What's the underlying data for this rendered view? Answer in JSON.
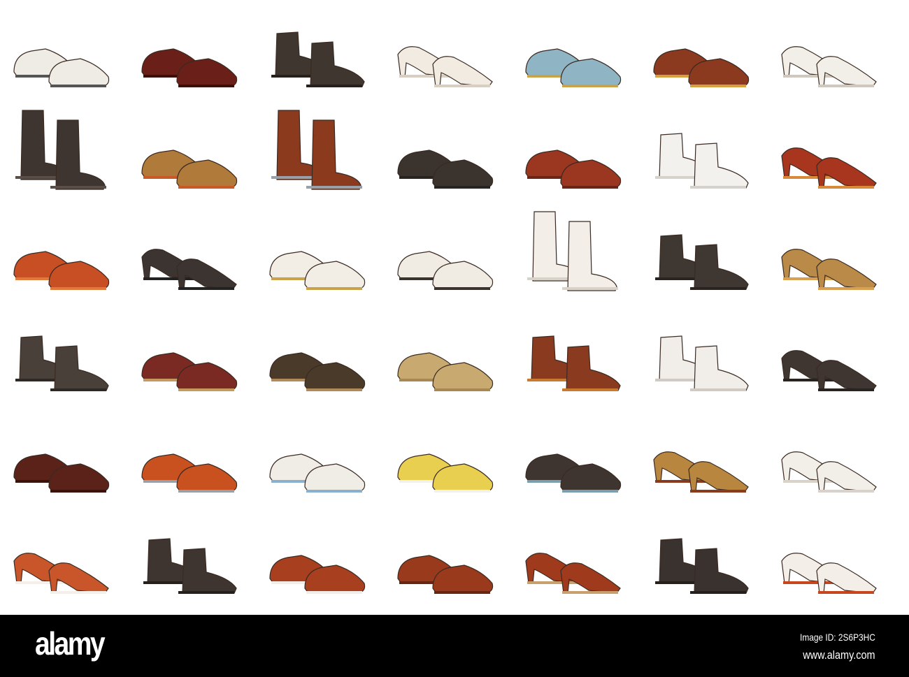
{
  "illustration": {
    "rows": [
      [
        {
          "c": "#efece6",
          "a": "#555"
        },
        {
          "c": "#6a2018",
          "a": "#3a100c"
        },
        {
          "c": "#3f3630",
          "a": "#25201c"
        },
        {
          "c": "#f1ebe2",
          "a": "#d8cfc2"
        },
        {
          "c": "#8fb4c3",
          "a": "#c9a24a"
        },
        {
          "c": "#8b3a1f",
          "a": "#d4a040"
        },
        {
          "c": "#f2eee8",
          "a": "#cfc8be"
        }
      ],
      [
        {
          "c": "#3e3530",
          "a": "#5a4f48"
        },
        {
          "c": "#b07a3a",
          "a": "#c85a25"
        },
        {
          "c": "#8c3a1e",
          "a": "#9aa0a8"
        },
        {
          "c": "#3a332e",
          "a": "#2a2420"
        },
        {
          "c": "#9b3620",
          "a": "#6e2414"
        },
        {
          "c": "#f3f1ee",
          "a": "#d5d2cc"
        },
        {
          "c": "#a8351e",
          "a": "#d88a3a"
        }
      ],
      [
        {
          "c": "#c84f23",
          "a": "#e07a3a"
        },
        {
          "c": "#3b3430",
          "a": "#222"
        },
        {
          "c": "#f2eee6",
          "a": "#c9a24a"
        },
        {
          "c": "#f0ece4",
          "a": "#3a322c"
        },
        {
          "c": "#f3efe8",
          "a": "#d8d2c8"
        },
        {
          "c": "#3e3732",
          "a": "#2a2420"
        },
        {
          "c": "#b98a48",
          "a": "#d8a050"
        }
      ],
      [
        {
          "c": "#4a403a",
          "a": "#2f2925"
        },
        {
          "c": "#7a2a22",
          "a": "#c49a60"
        },
        {
          "c": "#4a3a2a",
          "a": "#b08a5a"
        },
        {
          "c": "#c8aa70",
          "a": "#a88850"
        },
        {
          "c": "#8a3a1e",
          "a": "#c87a30"
        },
        {
          "c": "#f1ede8",
          "a": "#d0cac2"
        },
        {
          "c": "#3f3632",
          "a": "#2a2420"
        }
      ],
      [
        {
          "c": "#5a2218",
          "a": "#3a120c"
        },
        {
          "c": "#c9501f",
          "a": "#9aa0a8"
        },
        {
          "c": "#f0ece6",
          "a": "#8ab0d0"
        },
        {
          "c": "#e8cf50",
          "a": "#f3f1ee"
        },
        {
          "c": "#3e3530",
          "a": "#7aa0b0"
        },
        {
          "c": "#b8863e",
          "a": "#8a3a1e"
        },
        {
          "c": "#f2eee8",
          "a": "#d8d2ca"
        }
      ],
      [
        {
          "c": "#c8562a",
          "a": "#f4efe8"
        },
        {
          "c": "#3f3530",
          "a": "#25201c"
        },
        {
          "c": "#a8401f",
          "a": "#f2ede6"
        },
        {
          "c": "#9a3a1c",
          "a": "#6a2410"
        },
        {
          "c": "#a03a1c",
          "a": "#c8a070"
        },
        {
          "c": "#3a322e",
          "a": "#25201c"
        },
        {
          "c": "#f3efe8",
          "a": "#c8461e"
        }
      ]
    ]
  },
  "footer": {
    "logo": "alamy",
    "image_id": "Image ID: 2S6P3HC",
    "url": "www.alamy.com"
  }
}
